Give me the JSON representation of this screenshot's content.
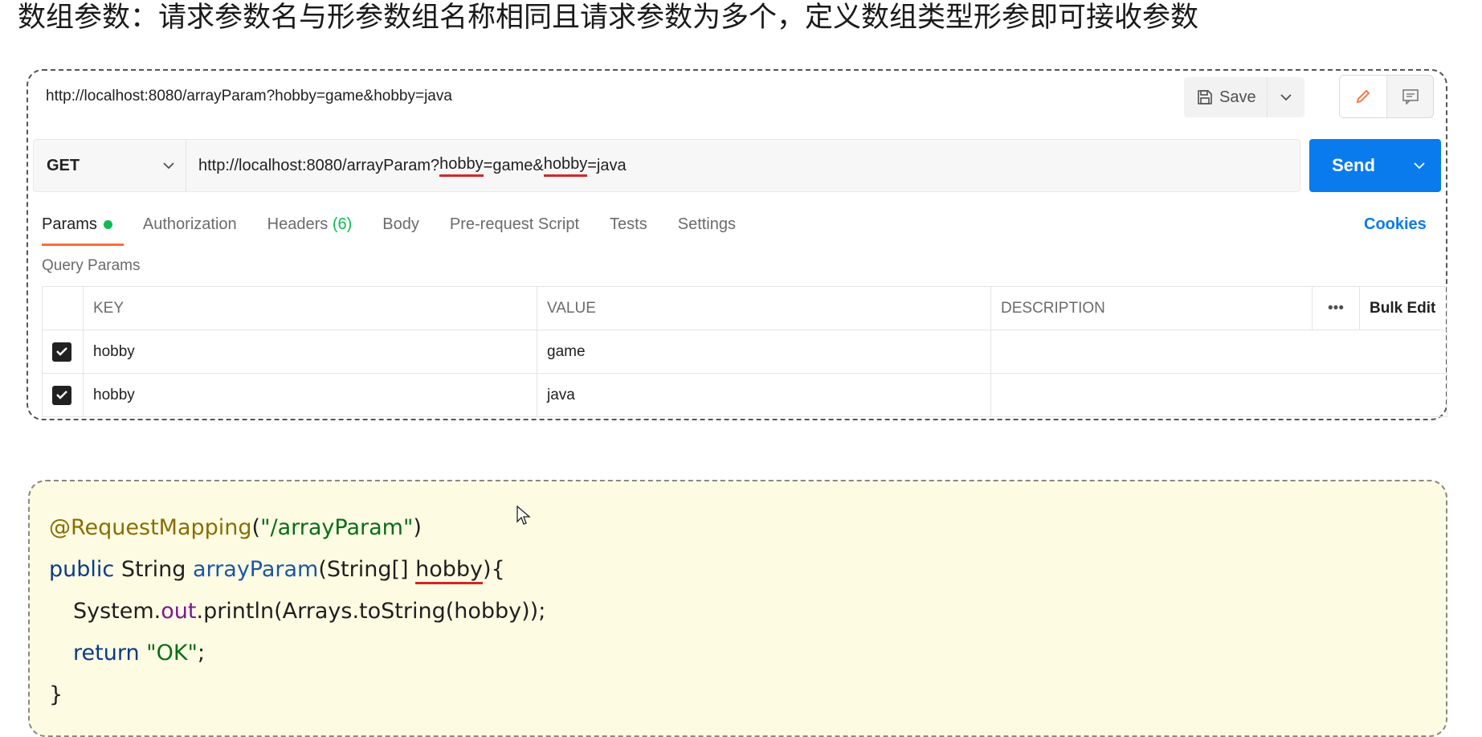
{
  "heading": "数组参数：请求参数名与形参数组名称相同且请求参数为多个，定义数组类型形参即可接收参数",
  "postman": {
    "request_title": "http://localhost:8080/arrayParam?hobby=game&hobby=java",
    "save_label": "Save",
    "method": "GET",
    "url": {
      "prefix": "http://localhost:8080/arrayParam?",
      "key1": "hobby",
      "mid1": "=game&",
      "key2": "hobby",
      "suffix": "=java"
    },
    "send_label": "Send",
    "tabs": {
      "params": "Params",
      "authorization": "Authorization",
      "headers": "Headers",
      "headers_count": "(6)",
      "body": "Body",
      "prerequest": "Pre-request Script",
      "tests": "Tests",
      "settings": "Settings"
    },
    "cookies_label": "Cookies",
    "query_params_label": "Query Params",
    "table": {
      "headers": {
        "key": "KEY",
        "value": "VALUE",
        "description": "DESCRIPTION",
        "more": "•••",
        "bulk_edit": "Bulk Edit"
      },
      "rows": [
        {
          "key": "hobby",
          "value": "game",
          "description": ""
        },
        {
          "key": "hobby",
          "value": "java",
          "description": ""
        }
      ]
    }
  },
  "code": {
    "annotation": "@RequestMapping",
    "ann_open": "(",
    "ann_str": "\"/arrayParam\"",
    "ann_close": ")",
    "kw_public": "public",
    "ret_type": " String ",
    "method_name": "arrayParam",
    "params_pre": "(String[] ",
    "param_name": "hobby",
    "params_post": "){",
    "body_sys": "System.",
    "body_out": "out",
    "body_rest": ".println(Arrays.toString(hobby));",
    "kw_return": "return",
    "ret_str": " \"OK\"",
    "ret_semi": ";",
    "close_brace": "}"
  }
}
